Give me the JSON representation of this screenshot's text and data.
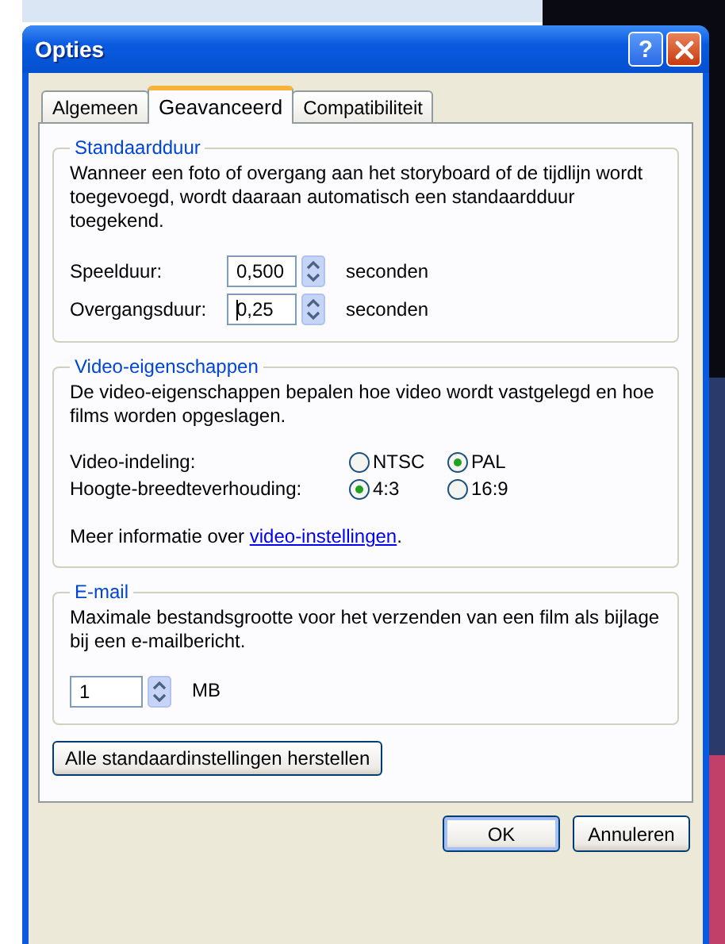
{
  "window": {
    "title": "Opties",
    "help_label": "?"
  },
  "tabs": [
    {
      "label": "Algemeen",
      "selected": false
    },
    {
      "label": "Geavanceerd",
      "selected": true
    },
    {
      "label": "Compatibiliteit",
      "selected": false
    }
  ],
  "duration_group": {
    "title": "Standaardduur",
    "description": "Wanneer een foto of overgang aan het storyboard of de tijdlijn wordt toegevoegd, wordt daaraan automatisch een standaardduur toegekend.",
    "fields": [
      {
        "label": "Speelduur:",
        "value": "0,500",
        "unit": "seconden",
        "focused": false
      },
      {
        "label": "Overgangsduur:",
        "value": "0,25",
        "unit": "seconden",
        "focused": true
      }
    ]
  },
  "video_group": {
    "title": "Video-eigenschappen",
    "description": "De video-eigenschappen bepalen hoe video wordt vastgelegd en hoe films worden opgeslagen.",
    "rows": [
      {
        "label": "Video-indeling:",
        "choices": [
          {
            "label": "NTSC",
            "selected": false
          },
          {
            "label": "PAL",
            "selected": true
          }
        ]
      },
      {
        "label": "Hoogte-breedteverhouding:",
        "choices": [
          {
            "label": "4:3",
            "selected": true
          },
          {
            "label": "16:9",
            "selected": false
          }
        ]
      }
    ],
    "info_text": "Meer informatie over ",
    "info_link": "video-instellingen",
    "info_end": "."
  },
  "email_group": {
    "title": "E-mail",
    "description": "Maximale bestandsgrootte voor het verzenden van een film als bijlage bij een e-mailbericht.",
    "value": "1",
    "unit": "MB"
  },
  "reset_button": "Alle standaardinstellingen herstellen",
  "buttons": [
    "OK",
    "Annuleren"
  ]
}
